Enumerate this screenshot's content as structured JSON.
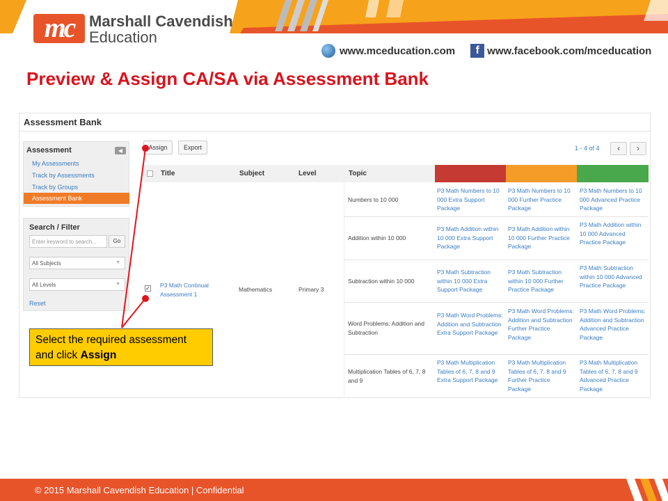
{
  "brand": {
    "logo_mark": "mc",
    "name": "Marshall Cavendish",
    "subname": "Education",
    "website": "www.mceducation.com",
    "facebook": "www.facebook.com/mceducation",
    "colors": {
      "orange": "#e8542a",
      "amber": "#f7a21b",
      "title_red": "#d9131d"
    }
  },
  "slide_title": "Preview & Assign CA/SA via Assessment Bank",
  "app": {
    "header": "Assessment Bank",
    "sidebar": {
      "title": "Assessment",
      "collapse_icon": "chevron-left-icon",
      "items": [
        {
          "label": "My Assessments",
          "active": false
        },
        {
          "label": "Track by Assessments",
          "active": false
        },
        {
          "label": "Track by Groups",
          "active": false
        },
        {
          "label": "Assessment Bank",
          "active": true
        }
      ]
    },
    "filter": {
      "title": "Search / Filter",
      "search_placeholder": "Enter keyword to search...",
      "go_label": "Go",
      "subject_value": "All Subjects",
      "level_value": "All Levels",
      "reset_label": "Reset"
    },
    "toolbar": {
      "assign_label": "Assign",
      "export_label": "Export"
    },
    "pagination": {
      "text": "1 - 4 of 4",
      "prev_icon": "chevron-left-icon",
      "next_icon": "chevron-right-icon"
    },
    "table": {
      "columns": [
        "Title",
        "Subject",
        "Level",
        "Topic"
      ],
      "level_colors": [
        "#c53a33",
        "#f59b28",
        "#4aa84c"
      ],
      "assessment": {
        "title": "P3 Math Continual Assessment 1",
        "subject": "Mathematics",
        "level": "Primary 3",
        "checked": true
      },
      "rows": [
        {
          "topic": "Numbers to 10 000",
          "packages": [
            "P3 Math Numbers to 10 000 Extra Support Package",
            "P3 Math Numbers to 10 000 Further Practice Package",
            "P3 Math Numbers to 10 000 Advanced Practice Package"
          ]
        },
        {
          "topic": "Addition within 10 000",
          "packages": [
            "P3 Math Addition within 10 000 Extra Support Package",
            "P3 Math Addition within 10 000 Further Practice Package",
            "P3 Math Addition within 10 000 Advanced Practice Package"
          ]
        },
        {
          "topic": "Subtraction within 10 000",
          "packages": [
            "P3 Math Subtraction within 10 000 Extra Support Package",
            "P3 Math Subtraction within 10 000 Further Practice Package",
            "P3 Math Subtraction within 10 000 Advanced Practice Package"
          ]
        },
        {
          "topic": "Word Problems: Addition and Subtraction",
          "packages": [
            "P3 Math Word Problems: Addition and Subtraction Extra Support Package",
            "P3 Math Word Problems: Addition and Subtraction Further Practice Package",
            "P3 Math Word Problems: Addition and Subtraction Advanced Practice Package"
          ]
        },
        {
          "topic": "Multiplication Tables of 6, 7, 8 and 9",
          "packages": [
            "P3 Math Multiplication Tables of 6, 7, 8 and 9 Extra Support Package",
            "P3 Math Multiplication Tables of 6, 7, 8 and 9 Further Practice Package",
            "P3 Math Multiplication Tables of 6, 7, 8 and 9 Advanced Practice Package"
          ]
        }
      ]
    }
  },
  "callout": {
    "text": "Select the required assessment and click",
    "bold": "Assign"
  },
  "footer": "© 2015 Marshall Cavendish Education | Confidential"
}
